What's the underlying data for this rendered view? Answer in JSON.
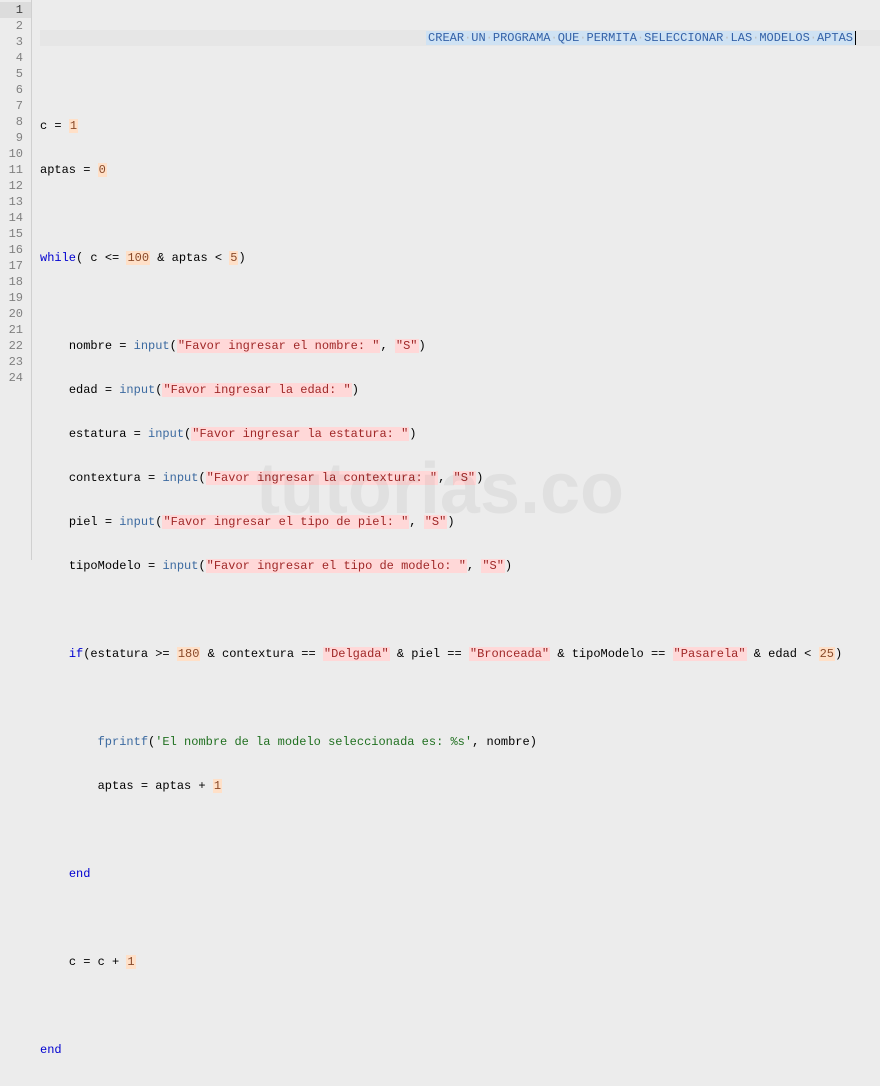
{
  "watermark": "tutorias.co",
  "gutter": {
    "start": 1,
    "end": 24,
    "current": 1
  },
  "title_comment": "CREAR UN PROGRAMA QUE PERMITA SELECCIONAR LAS MODELOS APTAS",
  "code": {
    "c_init": {
      "var": "c",
      "eq": "=",
      "val": "1"
    },
    "aptas_init": {
      "var": "aptas",
      "eq": "=",
      "val": "0"
    },
    "while": {
      "kw": "while",
      "open": "( c <= ",
      "n1": "100",
      "amp": " & aptas < ",
      "n2": "5",
      "close": ")"
    },
    "l8": {
      "lhs": "nombre = ",
      "fn": "input",
      "open": "(",
      "s1": "\"Favor ingresar el nombre: \"",
      "comma": ", ",
      "s2": "\"S\"",
      "close": ")"
    },
    "l9": {
      "lhs": "edad = ",
      "fn": "input",
      "open": "(",
      "s1": "\"Favor ingresar la edad: \"",
      "close": ")"
    },
    "l10": {
      "lhs": "estatura = ",
      "fn": "input",
      "open": "(",
      "s1": "\"Favor ingresar la estatura: \"",
      "close": ")"
    },
    "l11": {
      "lhs": "contextura = ",
      "fn": "input",
      "open": "(",
      "s1": "\"Favor ingresar la contextura: \"",
      "comma": ", ",
      "s2": "\"S\"",
      "close": ")"
    },
    "l12": {
      "lhs": "piel = ",
      "fn": "input",
      "open": "(",
      "s1": "\"Favor ingresar el tipo de piel: \"",
      "comma": ", ",
      "s2": "\"S\"",
      "close": ")"
    },
    "l13": {
      "lhs": "tipoModelo = ",
      "fn": "input",
      "open": "(",
      "s1": "\"Favor ingresar el tipo de modelo: \"",
      "comma": ", ",
      "s2": "\"S\"",
      "close": ")"
    },
    "l15": {
      "kw": "if",
      "open": "(estatura >= ",
      "n1": "180",
      "p2": " & contextura == ",
      "s1": "\"Delgada\"",
      "p3": " & piel == ",
      "s2": "\"Bronceada\"",
      "p4": " & tipoModelo == ",
      "s3": "\"Pasarela\"",
      "p5": " & edad < ",
      "n2": "25",
      "close": ")"
    },
    "l17": {
      "fn": "fprintf",
      "open": "(",
      "s1": "'El nombre de la modelo seleccionada es: %s'",
      "comma": ", nombre)",
      "close": ""
    },
    "l18": {
      "txt": "aptas = aptas + ",
      "n": "1"
    },
    "l20": {
      "kw": "end"
    },
    "l22": {
      "txt": "c = c + ",
      "n": "1"
    },
    "l24": {
      "kw": "end"
    }
  }
}
